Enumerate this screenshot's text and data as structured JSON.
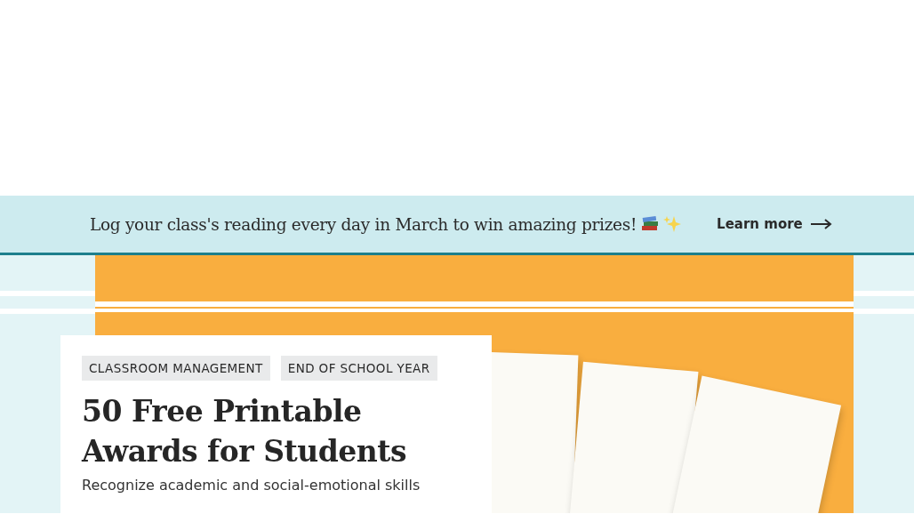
{
  "banner": {
    "message": "Log your class's reading every day in March to win amazing prizes!",
    "link": "Learn more"
  },
  "article": {
    "tags": [
      "CLASSROOM MANAGEMENT",
      "END OF SCHOOL YEAR"
    ],
    "title": "50 Free Printable Awards for Students",
    "description": "Recognize academic and social-emotional skills"
  }
}
